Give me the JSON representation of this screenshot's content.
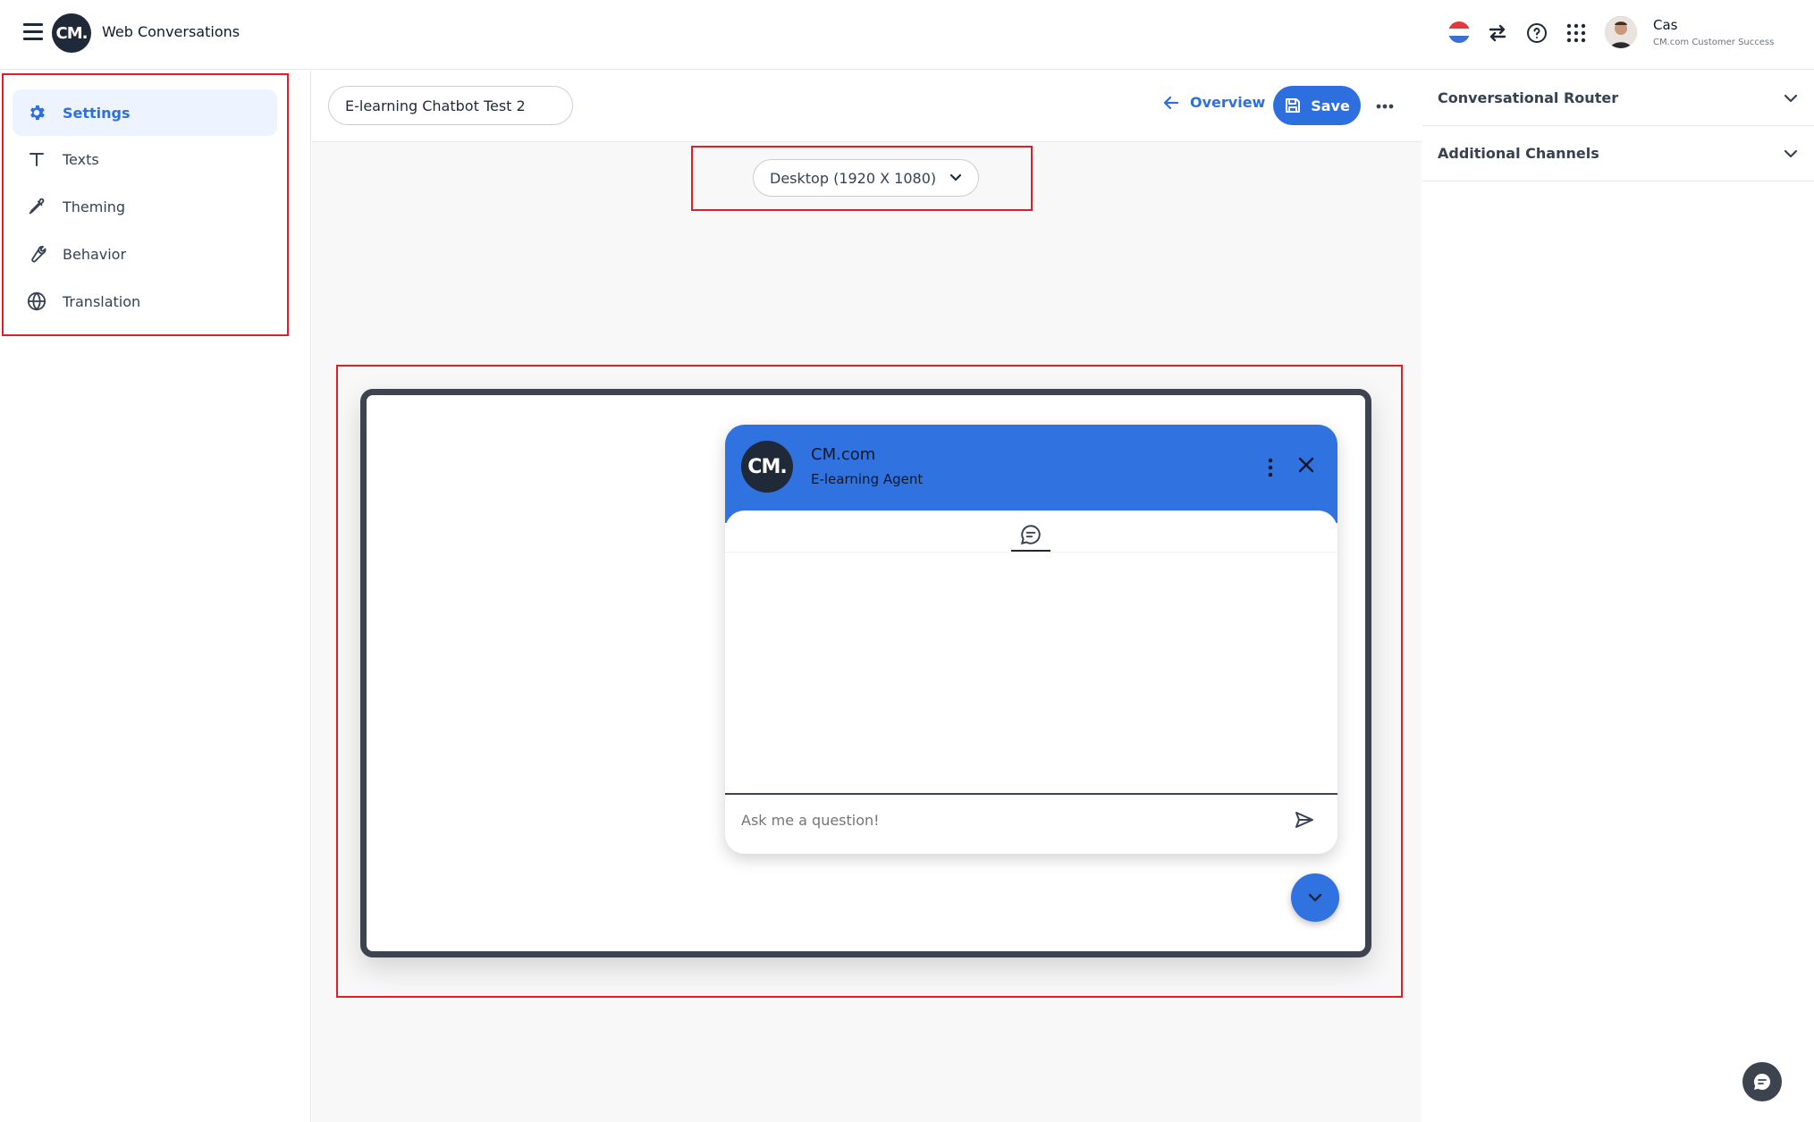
{
  "header": {
    "logo_text": "CM.",
    "app_title": "Web Conversations",
    "user": {
      "name": "Cas",
      "org": "CM.com Customer Success"
    }
  },
  "sidebar": {
    "items": [
      {
        "label": "Settings",
        "icon": "gear-icon",
        "active": true
      },
      {
        "label": "Texts",
        "icon": "text-icon"
      },
      {
        "label": "Theming",
        "icon": "eyedropper-icon"
      },
      {
        "label": "Behavior",
        "icon": "wrench-icon"
      },
      {
        "label": "Translation",
        "icon": "globe-icon"
      }
    ]
  },
  "editor": {
    "name_value": "E-learning Chatbot Test 2",
    "overview_label": "Overview",
    "save_label": "Save",
    "device_select": "Desktop (1920 X 1080)"
  },
  "chat": {
    "logo_text": "CM.",
    "title": "CM.com",
    "subtitle": "E-learning Agent",
    "input_placeholder": "Ask me a question!"
  },
  "right_panel": {
    "sections": [
      {
        "label": "Conversational Router"
      },
      {
        "label": "Additional Channels"
      }
    ]
  },
  "colors": {
    "accent": "#2e6fe0",
    "chat_header": "#2f72e0",
    "highlight_box": "#e11d2a"
  }
}
